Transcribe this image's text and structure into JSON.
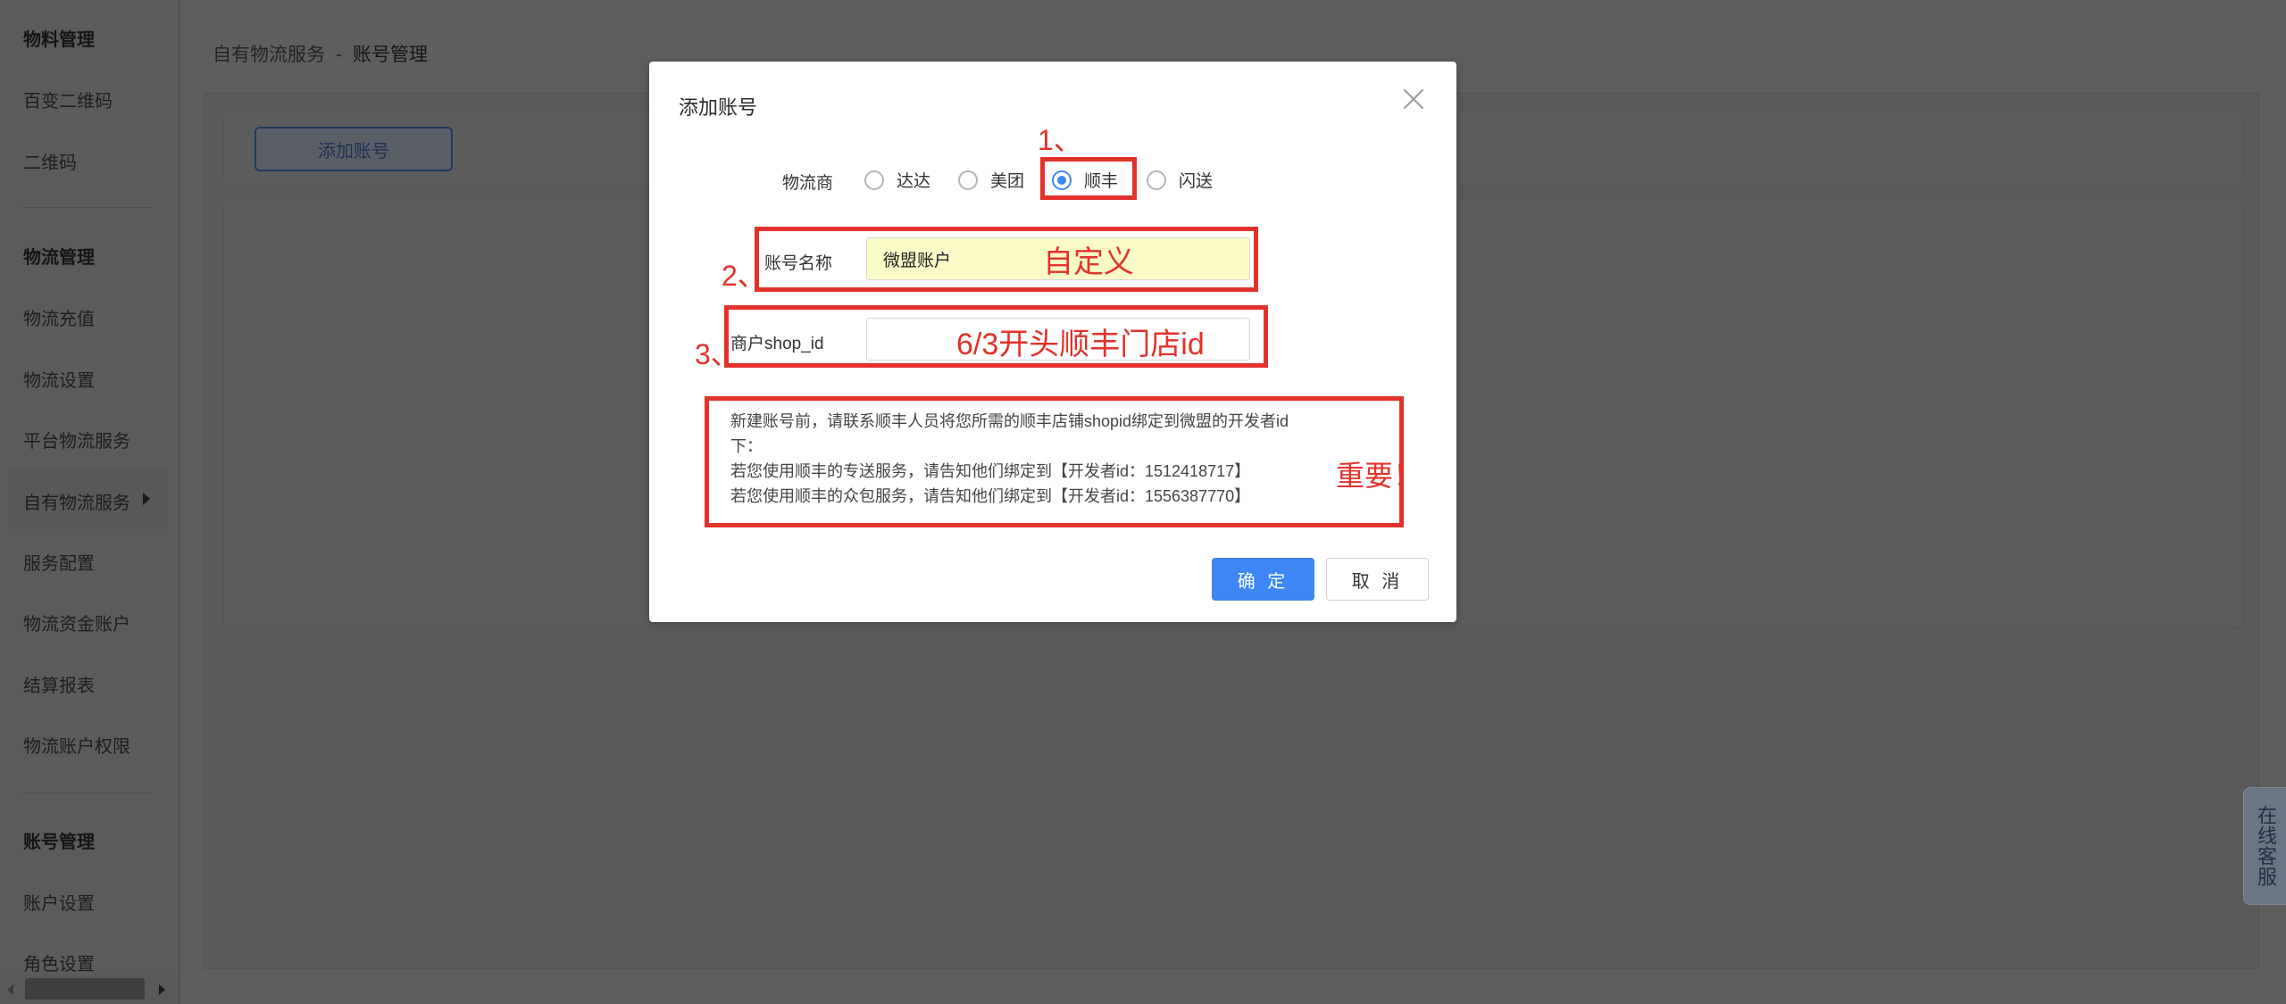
{
  "sidebar": {
    "sections": [
      {
        "title": "物料管理",
        "items": [
          "百变二维码",
          "二维码"
        ]
      },
      {
        "title": "物流管理",
        "items": [
          "物流充值",
          "物流设置",
          "平台物流服务",
          "自有物流服务",
          "服务配置",
          "物流资金账户",
          "结算报表",
          "物流账户权限"
        ]
      },
      {
        "title": "账号管理",
        "items": [
          "账户设置",
          "角色设置"
        ]
      }
    ],
    "active_item": "自有物流服务"
  },
  "breadcrumb": {
    "parent": "自有物流服务",
    "separator": "-",
    "current": "账号管理"
  },
  "toolbar": {
    "add_account_label": "添加账号"
  },
  "side_chat": {
    "label": "在线客服"
  },
  "modal": {
    "title": "添加账号",
    "provider": {
      "label": "物流商",
      "options": [
        "达达",
        "美团",
        "顺丰",
        "闪送"
      ],
      "selected": "顺丰"
    },
    "account_name": {
      "label": "账号名称",
      "value": "微盟账户"
    },
    "shop_id": {
      "label": "商户shop_id",
      "value": ""
    },
    "notice": [
      "新建账号前，请联系顺丰人员将您所需的顺丰店铺shopid绑定到微盟的开发者id",
      "下：",
      "若您使用顺丰的专送服务，请告知他们绑定到【开发者id：1512418717】",
      "若您使用顺丰的众包服务，请告知他们绑定到【开发者id：1556387770】"
    ],
    "confirm_label": "确 定",
    "cancel_label": "取 消"
  },
  "annotations": {
    "step1": "1、",
    "step2": "2、",
    "step3": "3、",
    "custom": "自定义",
    "shop_id_hint": "6/3开头顺丰门店id",
    "important": "重要！",
    "color": "#e2322b"
  },
  "colors": {
    "primary": "#3d86f4",
    "overlay": "#5e5e5e",
    "annotation": "#e2322b"
  }
}
